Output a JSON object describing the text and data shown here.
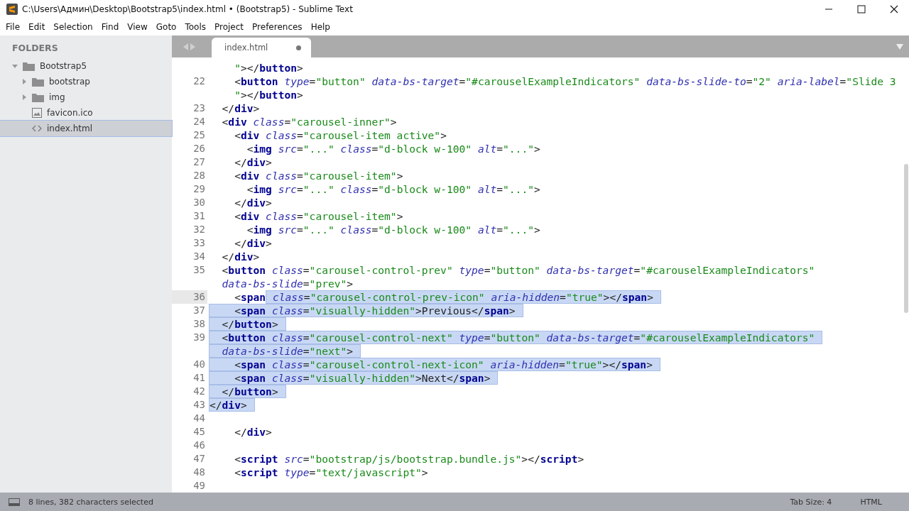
{
  "window": {
    "title": "C:\\Users\\Админ\\Desktop\\Bootstrap5\\index.html • (Bootstrap5) - Sublime Text"
  },
  "menu": [
    "File",
    "Edit",
    "Selection",
    "Find",
    "View",
    "Goto",
    "Tools",
    "Project",
    "Preferences",
    "Help"
  ],
  "sidebar": {
    "heading": "FOLDERS",
    "items": [
      {
        "label": "Bootstrap5",
        "kind": "folder",
        "expanded": true,
        "selected": false,
        "children": [
          {
            "label": "bootstrap",
            "kind": "folder",
            "expanded": false,
            "selected": false
          },
          {
            "label": "img",
            "kind": "folder",
            "expanded": false,
            "selected": false
          },
          {
            "label": "favicon.ico",
            "kind": "image",
            "selected": false
          },
          {
            "label": "index.html",
            "kind": "code",
            "selected": true
          }
        ]
      }
    ]
  },
  "tabs": [
    {
      "label": "index.html",
      "selected": true,
      "modified": true
    }
  ],
  "editor": {
    "lines": [
      {
        "current": false,
        "text": "    \"></button>"
      },
      {
        "number": "22",
        "current": false,
        "text": "    <button type=\"button\" data-bs-target=\"#carouselExampleIndicators\" data-bs-slide-to=\"2\" aria-label=\"Slide 3"
      },
      {
        "current": false,
        "text": "    \"></button>"
      },
      {
        "number": "23",
        "current": false,
        "text": "  </div>"
      },
      {
        "number": "24",
        "current": false,
        "text": "  <div class=\"carousel-inner\">"
      },
      {
        "number": "25",
        "current": false,
        "text": "    <div class=\"carousel-item active\">"
      },
      {
        "number": "26",
        "current": false,
        "text": "      <img src=\"...\" class=\"d-block w-100\" alt=\"...\">"
      },
      {
        "number": "27",
        "current": false,
        "text": "    </div>"
      },
      {
        "number": "28",
        "current": false,
        "text": "    <div class=\"carousel-item\">"
      },
      {
        "number": "29",
        "current": false,
        "text": "      <img src=\"...\" class=\"d-block w-100\" alt=\"...\">"
      },
      {
        "number": "30",
        "current": false,
        "text": "    </div>"
      },
      {
        "number": "31",
        "current": false,
        "text": "    <div class=\"carousel-item\">"
      },
      {
        "number": "32",
        "current": false,
        "text": "      <img src=\"...\" class=\"d-block w-100\" alt=\"...\">"
      },
      {
        "number": "33",
        "current": false,
        "text": "    </div>"
      },
      {
        "number": "34",
        "current": false,
        "text": "  </div>"
      },
      {
        "number": "35",
        "current": false,
        "text": "  <button class=\"carousel-control-prev\" type=\"button\" data-bs-target=\"#carouselExampleIndicators\""
      },
      {
        "current": false,
        "text": "  data-bs-slide=\"prev\">"
      },
      {
        "number": "36",
        "current": true,
        "text": "    <span",
        "selected_text": " class=\"carousel-control-prev-icon\" aria-hidden=\"true\"></span>"
      },
      {
        "number": "37",
        "current": false,
        "selected_text": "    <span class=\"visually-hidden\">Previous</span>"
      },
      {
        "number": "38",
        "current": false,
        "selected_text": "  </button>"
      },
      {
        "number": "39",
        "current": false,
        "selected_text": "  <button class=\"carousel-control-next\" type=\"button\" data-bs-target=\"#carouselExampleIndicators\""
      },
      {
        "current": false,
        "selected_text": "  data-bs-slide=\"next\">"
      },
      {
        "number": "40",
        "current": false,
        "selected_text": "    <span class=\"carousel-control-next-icon\" aria-hidden=\"true\"></span>"
      },
      {
        "number": "41",
        "current": false,
        "selected_text": "    <span class=\"visually-hidden\">Next</span>"
      },
      {
        "number": "42",
        "current": false,
        "selected_text": "  </button>"
      },
      {
        "number": "43",
        "current": false,
        "selected_text": "</div>"
      },
      {
        "number": "44",
        "current": false
      },
      {
        "number": "45",
        "current": false,
        "text": "    </div>"
      },
      {
        "number": "46",
        "current": false
      },
      {
        "number": "47",
        "current": false,
        "text": "    <script src=\"bootstrap/js/bootstrap.bundle.js\"></script>"
      },
      {
        "number": "48",
        "current": false,
        "text": "    <script type=\"text/javascript\">"
      },
      {
        "number": "49",
        "current": false
      }
    ]
  },
  "status_bar": {
    "message": "8 lines, 382 characters selected",
    "tab_size": "Tab Size: 4",
    "syntax": "HTML"
  }
}
